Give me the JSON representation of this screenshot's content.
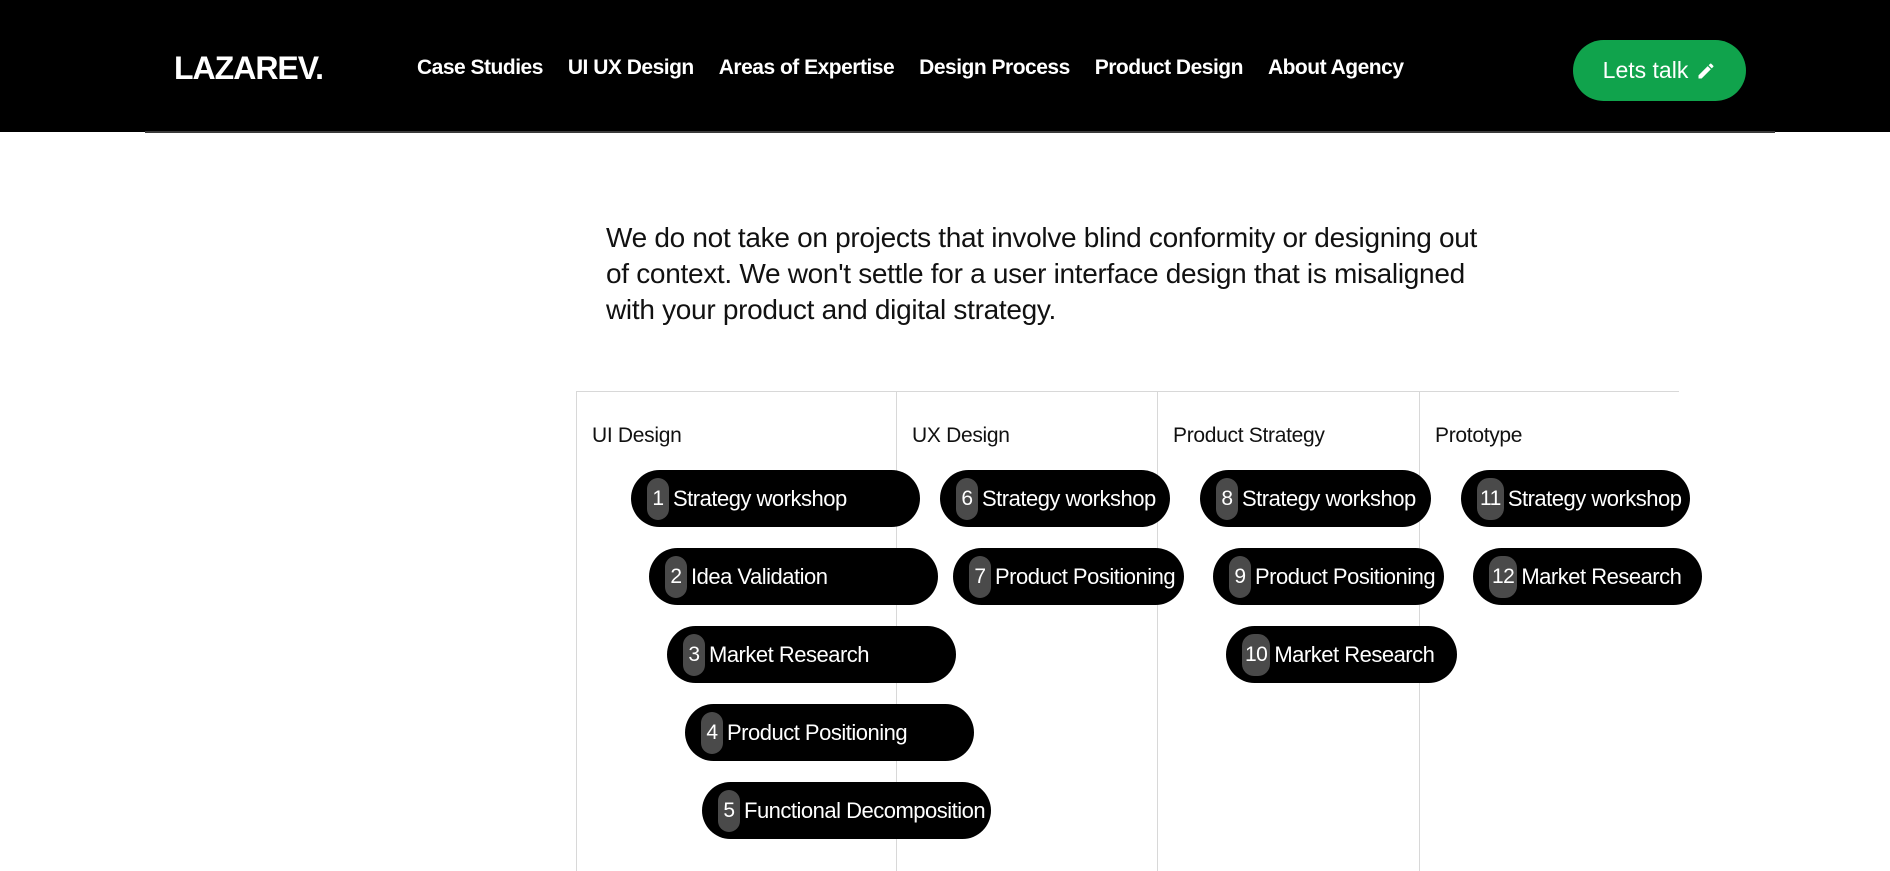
{
  "header": {
    "logo": "LAZAREV.",
    "nav": [
      "Case Studies",
      "UI UX Design",
      "Areas of Expertise",
      "Design Process",
      "Product Design",
      "About Agency"
    ],
    "cta_label": "Lets talk",
    "cta_icon": "pencil-icon",
    "cta_color": "#10a34c"
  },
  "intro": {
    "text": "We do not take on projects that involve blind conformity or designing out of context. We won't settle for a user interface design that is misaligned with your product and digital strategy."
  },
  "columns": [
    {
      "title": "UI Design",
      "steps": [
        {
          "num": "1",
          "label": "Strategy workshop"
        },
        {
          "num": "2",
          "label": "Idea Validation"
        },
        {
          "num": "3",
          "label": "Market Research"
        },
        {
          "num": "4",
          "label": "Product Positioning"
        },
        {
          "num": "5",
          "label": "Functional Decomposition"
        }
      ]
    },
    {
      "title": "UX Design",
      "steps": [
        {
          "num": "6",
          "label": "Strategy workshop"
        },
        {
          "num": "7",
          "label": "Product Positioning"
        }
      ]
    },
    {
      "title": "Product Strategy",
      "steps": [
        {
          "num": "8",
          "label": "Strategy workshop"
        },
        {
          "num": "9",
          "label": "Product Positioning"
        },
        {
          "num": "10",
          "label": "Market Research"
        }
      ]
    },
    {
      "title": "Prototype",
      "steps": [
        {
          "num": "11",
          "label": "Strategy workshop"
        },
        {
          "num": "12",
          "label": "Market Research"
        }
      ]
    }
  ]
}
